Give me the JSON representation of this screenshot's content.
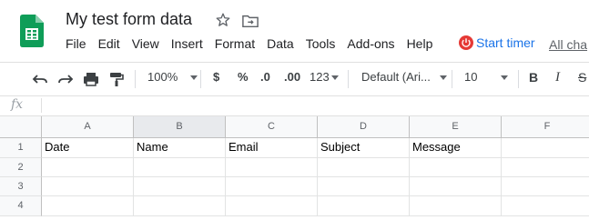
{
  "header": {
    "title": "My test form data",
    "menu": [
      "File",
      "Edit",
      "View",
      "Insert",
      "Format",
      "Data",
      "Tools",
      "Add-ons",
      "Help"
    ],
    "start_timer": "Start timer",
    "all_changes": "All cha"
  },
  "toolbar": {
    "zoom": "100%",
    "currency": "$",
    "percent": "%",
    "decrease_decimal": ".0",
    "increase_decimal": ".00",
    "more_formats": "123",
    "font": "Default (Ari...",
    "font_size": "10",
    "bold": "B",
    "italic": "I",
    "strike": "S"
  },
  "formula_bar": {
    "label": "fx",
    "value": ""
  },
  "grid": {
    "columns": [
      "A",
      "B",
      "C",
      "D",
      "E",
      "F"
    ],
    "rows": [
      "1",
      "2",
      "3",
      "4"
    ],
    "row1": [
      "Date",
      "Name",
      "Email",
      "Subject",
      "Message",
      ""
    ]
  },
  "colors": {
    "accent": "#1a73e8",
    "sheets_green": "#0f9d58",
    "timer_red": "#e53935"
  }
}
